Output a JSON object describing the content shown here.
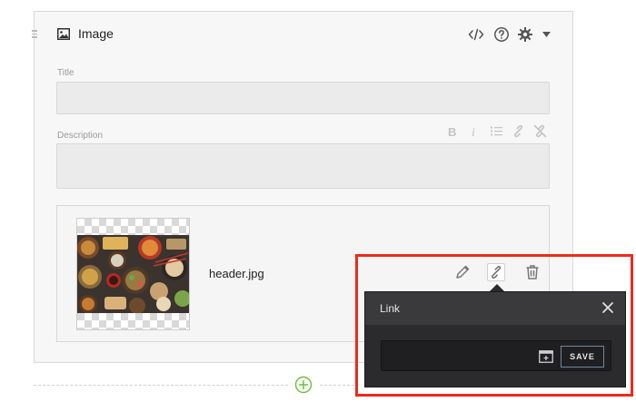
{
  "block": {
    "title": "Image",
    "header_icons": [
      "code-icon",
      "help-icon",
      "gear-icon",
      "caret-down-icon"
    ]
  },
  "fields": {
    "title_label": "Title",
    "title_value": "",
    "description_label": "Description",
    "description_value": "",
    "format_icons": [
      "bold-icon",
      "italic-icon",
      "list-icon",
      "link-icon",
      "unlink-icon"
    ]
  },
  "image": {
    "filename": "header.jpg",
    "actions": [
      "pencil-icon",
      "link-icon",
      "trash-icon"
    ]
  },
  "link_popover": {
    "title": "Link",
    "input_value": "",
    "save_label": "SAVE"
  },
  "colors": {
    "highlight": "#ee2a1b",
    "add_button": "#6cbf3c",
    "popover_bg": "#2b2b2e"
  }
}
